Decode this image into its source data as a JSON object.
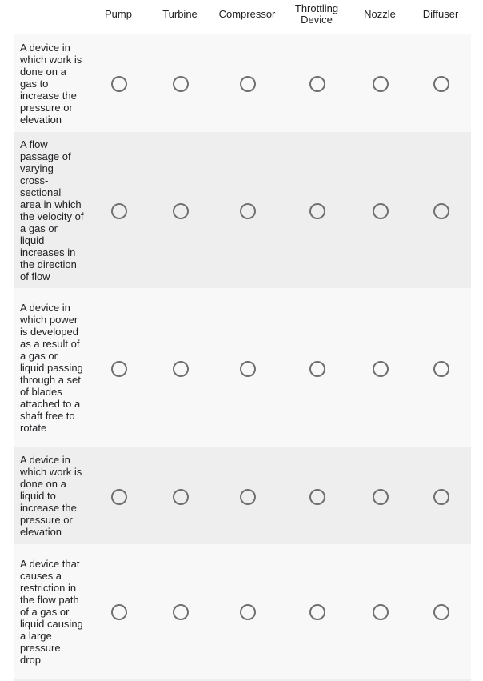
{
  "columns": [
    "Pump",
    "Turbine",
    "Compressor",
    "Throttling Device",
    "Nozzle",
    "Diffuser"
  ],
  "rows": [
    {
      "label": "A device in which work is done on a gas to increase the pressure or elevation",
      "selected": null
    },
    {
      "label": "A flow passage of varying cross-sectional area in which the velocity of a gas or liquid increases in the direction of flow",
      "selected": null
    },
    {
      "label": "A device in which power is developed as a result of a gas or liquid passing through a set of blades attached to a shaft free to rotate",
      "selected": null
    },
    {
      "label": "A device in which work is done on a liquid to increase the pressure or elevation",
      "selected": null
    },
    {
      "label": "A device that causes a restriction in the flow path of a gas or liquid causing a large pressure drop",
      "selected": null
    }
  ]
}
